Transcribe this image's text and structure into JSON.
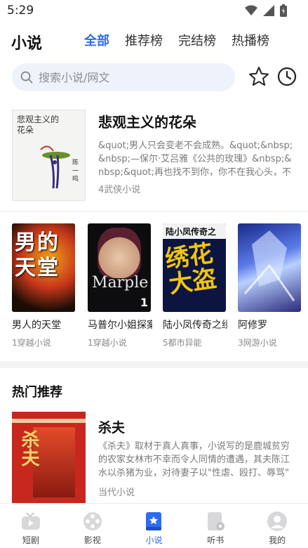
{
  "status": {
    "time": "5:29"
  },
  "header": {
    "title": "小说",
    "tabs": [
      {
        "label": "全部",
        "active": true
      },
      {
        "label": "推荐榜",
        "active": false
      },
      {
        "label": "完结榜",
        "active": false
      },
      {
        "label": "热播榜",
        "active": false
      }
    ]
  },
  "search": {
    "placeholder": "搜索小说/网文",
    "value": ""
  },
  "featured": {
    "title": "悲观主义的花朵",
    "description": "&quot;男人只会变老不会成熟。&quot;&nbsp;&nbsp;—保尔·艾吕雅《公共的玫瑰》&nbsp;&nbsp;&quot;再也找不到你，你不在我心头，不",
    "meta": "4武侠小说",
    "cover": {
      "title": "悲观主义的花朵",
      "author": "陈 一 鸣"
    }
  },
  "book_row": [
    {
      "name": "男人的天堂",
      "meta": "1穿越小说",
      "cover": {
        "text": "男的天堂"
      }
    },
    {
      "name": "马普尔小姐探案",
      "meta": "1穿越小说",
      "cover": {
        "text": "Marple"
      }
    },
    {
      "name": "陆小凤传奇之绣花大盗",
      "meta": "5都市异能",
      "cover": {
        "text": "陆小凤传奇之"
      }
    },
    {
      "name": "阿修罗",
      "meta": "3网游小说",
      "cover": {
        "text": ""
      }
    }
  ],
  "hot": {
    "section_title": "热门推荐",
    "items": [
      {
        "title": "杀夫",
        "description": "《杀夫》取材于真人真事，小说写的是鹿城贫穷的农家女林市不幸而令人同情的遭遇，其夫陈江水以杀猪为业，对待妻子以\"性虐、殴打、辱骂\"",
        "meta": "当代小说",
        "cover": {
          "text": "杀夫"
        }
      }
    ]
  },
  "bottom_nav": [
    {
      "label": "短剧",
      "icon": "tv-icon",
      "active": false
    },
    {
      "label": "影视",
      "icon": "film-reel-icon",
      "active": false
    },
    {
      "label": "小说",
      "icon": "book-icon",
      "active": true
    },
    {
      "label": "听书",
      "icon": "audio-book-icon",
      "active": false
    },
    {
      "label": "我的",
      "icon": "user-icon",
      "active": false
    }
  ],
  "colors": {
    "accent": "#2d6cf0",
    "search_bg": "#eef2fb",
    "divider": "#f3f3f5"
  }
}
